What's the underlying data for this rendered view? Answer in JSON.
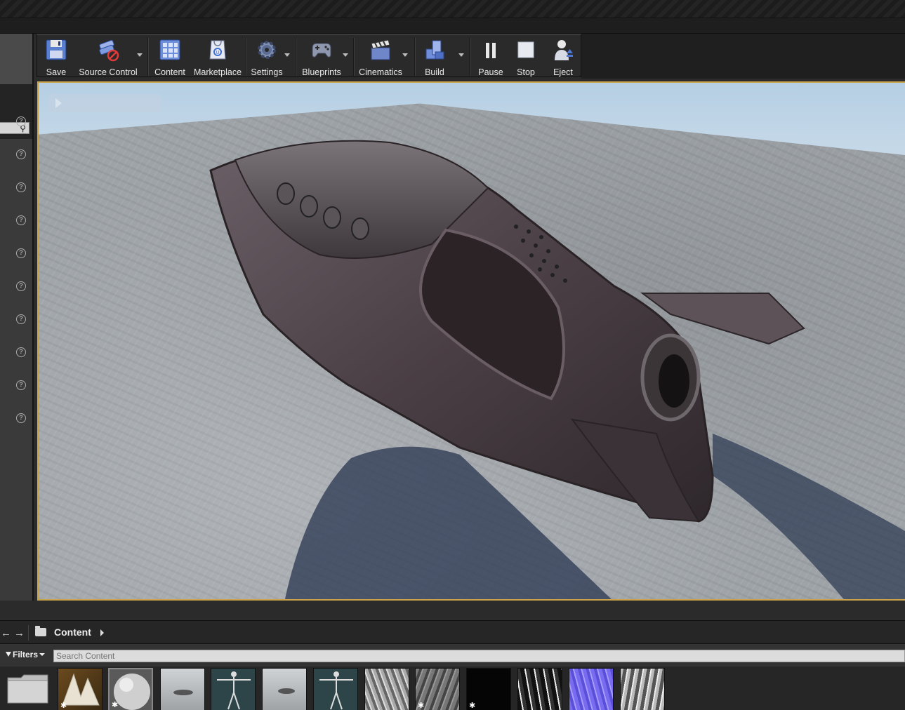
{
  "toolbar": {
    "buttons": [
      {
        "label": "Save",
        "icon": "save-icon"
      },
      {
        "label": "Source Control",
        "icon": "source-control-icon"
      },
      {
        "label": "Content",
        "icon": "content-browser-icon"
      },
      {
        "label": "Marketplace",
        "icon": "marketplace-icon"
      },
      {
        "label": "Settings",
        "icon": "settings-gear-icon"
      },
      {
        "label": "Blueprints",
        "icon": "blueprints-gamepad-icon"
      },
      {
        "label": "Cinematics",
        "icon": "cinematics-clapper-icon"
      },
      {
        "label": "Build",
        "icon": "build-blocks-icon"
      },
      {
        "label": "Pause",
        "icon": "pause-icon"
      },
      {
        "label": "Stop",
        "icon": "stop-icon"
      },
      {
        "label": "Eject",
        "icon": "eject-person-icon"
      }
    ]
  },
  "content_browser": {
    "path_label": "Content",
    "filters_label": "Filters",
    "search_placeholder": "Search Content",
    "assets": [
      {
        "kind": "folder"
      },
      {
        "kind": "static-mesh-landscape"
      },
      {
        "kind": "material-sphere"
      },
      {
        "kind": "static-mesh-ship"
      },
      {
        "kind": "skeleton"
      },
      {
        "kind": "static-mesh-ship"
      },
      {
        "kind": "skeleton"
      },
      {
        "kind": "texture-roughness"
      },
      {
        "kind": "texture-albedo"
      },
      {
        "kind": "texture-black"
      },
      {
        "kind": "texture-mask"
      },
      {
        "kind": "texture-normal"
      },
      {
        "kind": "texture-ao"
      }
    ]
  },
  "colors": {
    "viewport_border": "#c9a44a",
    "ship_hull": "#4a3f44",
    "sky": "#b6cfe4",
    "ground": "#9ea3a8"
  }
}
